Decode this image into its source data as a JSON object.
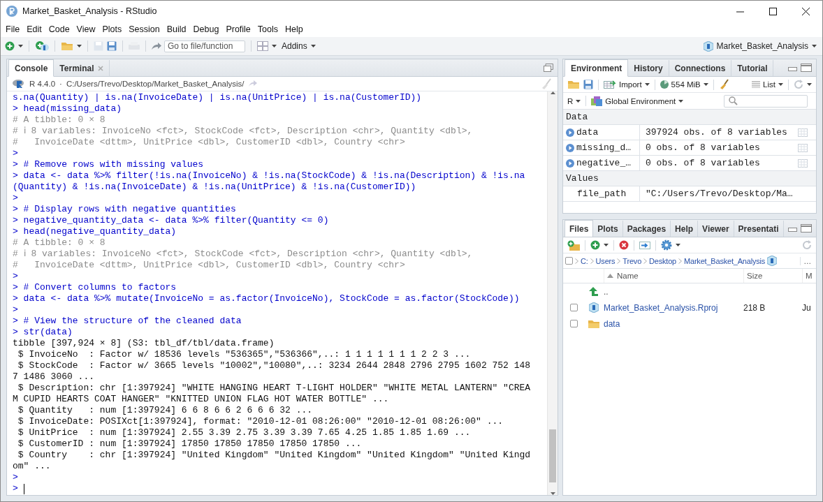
{
  "window": {
    "title": "Market_Basket_Analysis - RStudio"
  },
  "menu": [
    "File",
    "Edit",
    "Code",
    "View",
    "Plots",
    "Session",
    "Build",
    "Debug",
    "Profile",
    "Tools",
    "Help"
  ],
  "toolbar": {
    "goto_placeholder": "Go to file/function",
    "addins": "Addins",
    "project": "Market_Basket_Analysis"
  },
  "console": {
    "tabs": [
      {
        "label": "Console",
        "selected": true,
        "closable": false
      },
      {
        "label": "Terminal",
        "selected": false,
        "closable": true
      }
    ],
    "version": "R 4.4.0",
    "separator": "·",
    "path": "C:/Users/Trevo/Desktop/Market_Basket_Analysis/",
    "lines": [
      {
        "kind": "input",
        "text": "s.na(Quantity) | is.na(InvoiceDate) | is.na(UnitPrice) | is.na(CustomerID))"
      },
      {
        "kind": "input",
        "text": "> head(missing_data)"
      },
      {
        "kind": "comment",
        "text": "# A tibble: 0 × 8"
      },
      {
        "kind": "comment",
        "text": "# ℹ 8 variables: InvoiceNo <fct>, StockCode <fct>, Description <chr>, Quantity <dbl>,"
      },
      {
        "kind": "comment",
        "text": "#   InvoiceDate <dttm>, UnitPrice <dbl>, CustomerID <dbl>, Country <chr>"
      },
      {
        "kind": "input",
        "text": ">"
      },
      {
        "kind": "input",
        "text": "> # Remove rows with missing values"
      },
      {
        "kind": "input",
        "text": "> data <- data %>% filter(!is.na(InvoiceNo) & !is.na(StockCode) & !is.na(Description) & !is.na"
      },
      {
        "kind": "input",
        "text": "(Quantity) & !is.na(InvoiceDate) & !is.na(UnitPrice) & !is.na(CustomerID))"
      },
      {
        "kind": "input",
        "text": ">"
      },
      {
        "kind": "input",
        "text": "> # Display rows with negative quantities"
      },
      {
        "kind": "input",
        "text": "> negative_quantity_data <- data %>% filter(Quantity <= 0)"
      },
      {
        "kind": "input",
        "text": "> head(negative_quantity_data)"
      },
      {
        "kind": "comment",
        "text": "# A tibble: 0 × 8"
      },
      {
        "kind": "comment",
        "text": "# ℹ 8 variables: InvoiceNo <fct>, StockCode <fct>, Description <chr>, Quantity <dbl>,"
      },
      {
        "kind": "comment",
        "text": "#   InvoiceDate <dttm>, UnitPrice <dbl>, CustomerID <dbl>, Country <chr>"
      },
      {
        "kind": "input",
        "text": ">"
      },
      {
        "kind": "input",
        "text": "> # Convert columns to factors"
      },
      {
        "kind": "input",
        "text": "> data <- data %>% mutate(InvoiceNo = as.factor(InvoiceNo), StockCode = as.factor(StockCode))"
      },
      {
        "kind": "input",
        "text": ">"
      },
      {
        "kind": "input",
        "text": "> # View the structure of the cleaned data"
      },
      {
        "kind": "input",
        "text": "> str(data)"
      },
      {
        "kind": "output",
        "text": "tibble [397,924 × 8] (S3: tbl_df/tbl/data.frame)"
      },
      {
        "kind": "output",
        "text": " $ InvoiceNo  : Factor w/ 18536 levels \"536365\",\"536366\",..: 1 1 1 1 1 1 1 2 2 3 ..."
      },
      {
        "kind": "output",
        "text": " $ StockCode  : Factor w/ 3665 levels \"10002\",\"10080\",..: 3234 2644 2848 2796 2795 1602 752 148"
      },
      {
        "kind": "output",
        "text": "7 1486 3060 ..."
      },
      {
        "kind": "output",
        "text": " $ Description: chr [1:397924] \"WHITE HANGING HEART T-LIGHT HOLDER\" \"WHITE METAL LANTERN\" \"CREA"
      },
      {
        "kind": "output",
        "text": "M CUPID HEARTS COAT HANGER\" \"KNITTED UNION FLAG HOT WATER BOTTLE\" ..."
      },
      {
        "kind": "output",
        "text": " $ Quantity   : num [1:397924] 6 6 8 6 6 2 6 6 6 32 ..."
      },
      {
        "kind": "output",
        "text": " $ InvoiceDate: POSIXct[1:397924], format: \"2010-12-01 08:26:00\" \"2010-12-01 08:26:00\" ..."
      },
      {
        "kind": "output",
        "text": " $ UnitPrice  : num [1:397924] 2.55 3.39 2.75 3.39 3.39 7.65 4.25 1.85 1.85 1.69 ..."
      },
      {
        "kind": "output",
        "text": " $ CustomerID : num [1:397924] 17850 17850 17850 17850 17850 ..."
      },
      {
        "kind": "output",
        "text": " $ Country    : chr [1:397924] \"United Kingdom\" \"United Kingdom\" \"United Kingdom\" \"United Kingd"
      },
      {
        "kind": "output",
        "text": "om\" ..."
      },
      {
        "kind": "input",
        "text": ">"
      },
      {
        "kind": "prompt",
        "text": ">"
      }
    ]
  },
  "environment": {
    "tabs": [
      {
        "label": "Environment",
        "selected": true
      },
      {
        "label": "History",
        "selected": false
      },
      {
        "label": "Connections",
        "selected": false
      },
      {
        "label": "Tutorial",
        "selected": false
      }
    ],
    "import": "Import",
    "memory": "554 MiB",
    "view": "List",
    "language": "R",
    "scope": "Global Environment",
    "sections": [
      {
        "title": "Data",
        "rows": [
          {
            "kind": "data",
            "name": "data",
            "value": "397924 obs. of 8 variables"
          },
          {
            "kind": "data",
            "name": "missing_d…",
            "value": "0 obs. of 8 variables"
          },
          {
            "kind": "data",
            "name": "negative_…",
            "value": "0 obs. of 8 variables"
          }
        ]
      },
      {
        "title": "Values",
        "rows": [
          {
            "kind": "value",
            "name": "file_path",
            "value": "\"C:/Users/Trevo/Desktop/Ma…"
          }
        ]
      }
    ]
  },
  "files": {
    "tabs": [
      {
        "label": "Files",
        "selected": true
      },
      {
        "label": "Plots",
        "selected": false
      },
      {
        "label": "Packages",
        "selected": false
      },
      {
        "label": "Help",
        "selected": false
      },
      {
        "label": "Viewer",
        "selected": false
      },
      {
        "label": "Presentati",
        "selected": false
      }
    ],
    "select_all_checked": false,
    "breadcrumb": [
      "C:",
      "Users",
      "Trevo",
      "Desktop",
      "Market_Basket_Analysis"
    ],
    "more": "…",
    "columns": [
      "Name",
      "Size",
      "M"
    ],
    "rows": [
      {
        "kind": "parent",
        "name": ".."
      },
      {
        "kind": "project",
        "name": "Market_Basket_Analysis.Rproj",
        "size": "218 B",
        "modified": "Ju",
        "checked": false
      },
      {
        "kind": "folder",
        "name": "data",
        "checked": false
      }
    ]
  }
}
